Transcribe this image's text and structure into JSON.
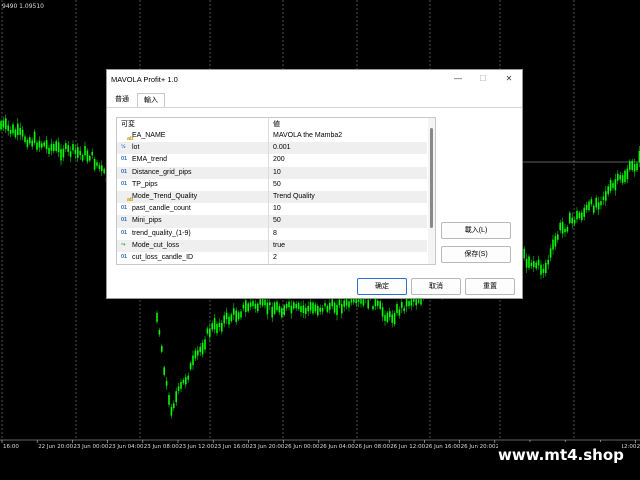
{
  "chart": {
    "price_text": "9490 1.09510",
    "time_labels": [
      "16:00",
      "22 Jun 20:00",
      "23 Jun 00:00",
      "23 Jun 04:00",
      "23 Jun 08:00",
      "23 Jun 12:00",
      "23 Jun 16:00",
      "23 Jun 20:00",
      "26 Jun 00:00",
      "26 Jun 04:00",
      "26 Jun 08:00",
      "26 Jun 12:00",
      "26 Jun 16:00",
      "26 Jun 20:00",
      "27 Jun 00:00",
      "27 Jun 04:00",
      "27 Jun 08:00",
      "27 Jun 12:00",
      "27 Jun"
    ],
    "candle_color": "#00ff00",
    "grid_color": "#888888"
  },
  "watermark": "www.mt4.shop",
  "dialog": {
    "title": "MAVOLA Profit+ 1.0",
    "controls": {
      "minimize": "—",
      "maximize": "☐",
      "close": "✕"
    },
    "tabs": [
      {
        "label": "普通",
        "active": false
      },
      {
        "label": "輸入",
        "active": true
      }
    ],
    "grid": {
      "col_variable": "可変",
      "col_value": "値",
      "rows": [
        {
          "icon": "ab",
          "name": "EA_NAME",
          "value": "MAVOLA the Mamba2"
        },
        {
          "icon": "½",
          "name": "lot",
          "value": "0.001"
        },
        {
          "icon": "01",
          "name": "EMA_trend",
          "value": "200"
        },
        {
          "icon": "01",
          "name": "Distance_grid_pips",
          "value": "10"
        },
        {
          "icon": "01",
          "name": "TP_pips",
          "value": "50"
        },
        {
          "icon": "ab",
          "name": "Mode_Trend_Quality",
          "value": "Trend Quality"
        },
        {
          "icon": "01",
          "name": "past_candle_count",
          "value": "10"
        },
        {
          "icon": "01",
          "name": "Mini_pips",
          "value": "50"
        },
        {
          "icon": "01",
          "name": "trend_quality_(1-9)",
          "value": "8"
        },
        {
          "icon": "⤳",
          "name": "Mode_cut_loss",
          "value": "true"
        },
        {
          "icon": "01",
          "name": "cut_loss_candle_ID",
          "value": "2"
        }
      ]
    },
    "side_buttons": {
      "load": "載入(L)",
      "save": "保存(S)"
    },
    "bottom_buttons": {
      "ok": "确定",
      "cancel": "取消",
      "reset": "重置"
    }
  }
}
